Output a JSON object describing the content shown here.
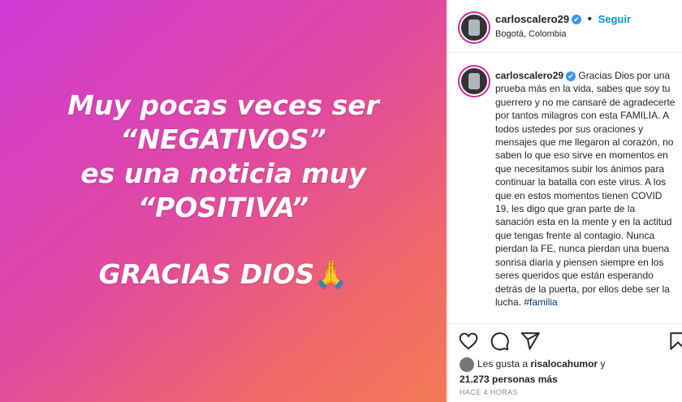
{
  "image": {
    "lines": [
      "Muy pocas veces ser",
      "“NEGATIVOS”",
      "es una noticia muy",
      "“POSITIVA”"
    ],
    "closing": "GRACIAS DIOS",
    "emoji": "🙏"
  },
  "header": {
    "username": "carloscalero29",
    "verified": "✔",
    "separator": "•",
    "follow_label": "Seguir",
    "location": "Bogotá, Colombia"
  },
  "caption": {
    "username": "carloscalero29",
    "verified": "✔",
    "text": "Gracias Dios por una prueba más en la vida, sabes que soy tu guerrero y no me cansaré de agradecerte por tantos milagros con esta FAMILIA. A todos ustedes por sus oraciones y mensajes que me llegaron al corazón, no saben lo que eso sirve en momentos en que necesitamos subir los ánimos para continuar la batalla con este virus. A los que en estos momentos tienen COVID 19, les digo que gran parte de la sanación esta en la mente y en la actitud que tengas frente al contagio. Nunca pierdan la FE, nunca pierdan una buena sonrisa diaria y piensen siempre en los seres queridos que están esperando detrás de la puerta, por ellos debe ser la lucha.",
    "hashtag": "#familia"
  },
  "actions": {
    "like_icon": "heart-icon",
    "comment_icon": "comment-icon",
    "share_icon": "share-icon",
    "save_icon": "bookmark-icon"
  },
  "likes": {
    "prefix": "Les gusta a",
    "user": "risalocahumor",
    "connector": "y",
    "count": "21.273 personas más"
  },
  "timestamp": "HACE 4 HORAS",
  "colors": {
    "accent": "#0095f6",
    "verified": "#3897f0"
  }
}
